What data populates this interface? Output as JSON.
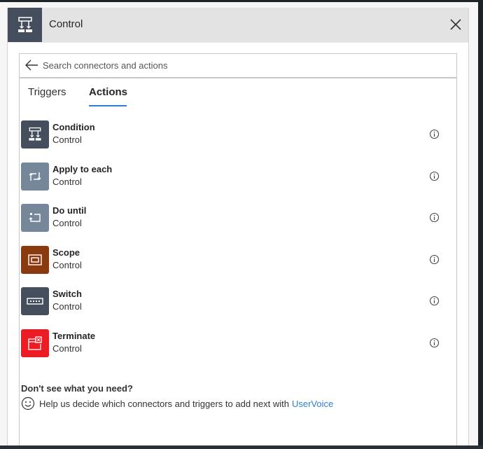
{
  "header": {
    "title": "Control",
    "icon": "condition-icon",
    "icon_bg": "#454e5c",
    "close_icon": "close-icon"
  },
  "search": {
    "placeholder": "Search connectors and actions",
    "value": "",
    "back_icon": "back-arrow-icon"
  },
  "tabs": [
    {
      "label": "Triggers",
      "active": false
    },
    {
      "label": "Actions",
      "active": true
    }
  ],
  "accent_color": "#2d7fd2",
  "actions": [
    {
      "name": "Condition",
      "connector": "Control",
      "icon": "condition-icon",
      "color": "#454e5c"
    },
    {
      "name": "Apply to each",
      "connector": "Control",
      "icon": "loop-icon",
      "color": "#77879a"
    },
    {
      "name": "Do until",
      "connector": "Control",
      "icon": "do-until-icon",
      "color": "#77879a"
    },
    {
      "name": "Scope",
      "connector": "Control",
      "icon": "scope-icon",
      "color": "#8b3a10"
    },
    {
      "name": "Switch",
      "connector": "Control",
      "icon": "switch-icon",
      "color": "#454e5c"
    },
    {
      "name": "Terminate",
      "connector": "Control",
      "icon": "terminate-icon",
      "color": "#ec1c24"
    }
  ],
  "footer": {
    "question": "Don't see what you need?",
    "help_text": "Help us decide which connectors and triggers to add next with",
    "link_text": "UserVoice"
  }
}
